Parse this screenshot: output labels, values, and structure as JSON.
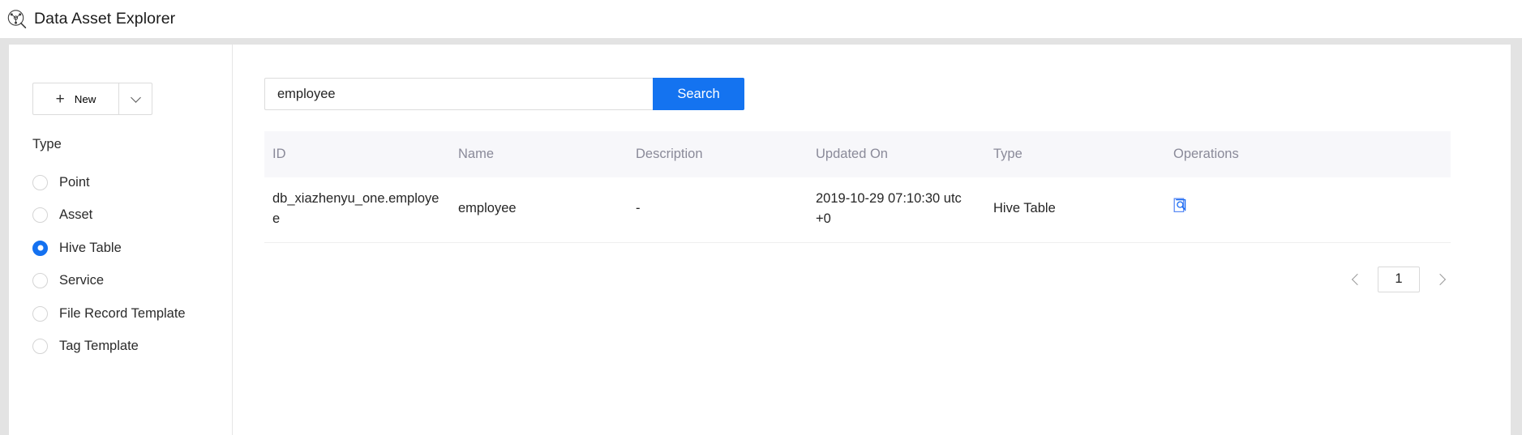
{
  "header": {
    "title": "Data Asset Explorer",
    "logo_icon": "graph-search-icon"
  },
  "sidebar": {
    "new_button": {
      "label": "New",
      "plus_icon": "plus-icon",
      "dropdown_icon": "chevron-down-icon"
    },
    "filter_group_title": "Type",
    "type_options": [
      {
        "label": "Point",
        "selected": false
      },
      {
        "label": "Asset",
        "selected": false
      },
      {
        "label": "Hive Table",
        "selected": true
      },
      {
        "label": "Service",
        "selected": false
      },
      {
        "label": "File Record Template",
        "selected": false
      },
      {
        "label": "Tag Template",
        "selected": false
      }
    ]
  },
  "search": {
    "value": "employee",
    "placeholder": "",
    "button_label": "Search"
  },
  "table": {
    "columns": [
      "ID",
      "Name",
      "Description",
      "Updated On",
      "Type",
      "Operations"
    ],
    "rows": [
      {
        "id": "db_xiazhenyu_one.employee",
        "name": "employee",
        "description": "-",
        "updated_on": "2019-10-29 07:10:30 utc +0",
        "type": "Hive Table",
        "operation_icon": "file-search-icon"
      }
    ]
  },
  "pagination": {
    "prev_icon": "chevron-left-icon",
    "next_icon": "chevron-right-icon",
    "page": "1"
  },
  "colors": {
    "accent": "#1473f0",
    "page_background": "#e3e3e3",
    "table_header_background": "#f7f7fa",
    "header_text": "#8a8a99"
  }
}
